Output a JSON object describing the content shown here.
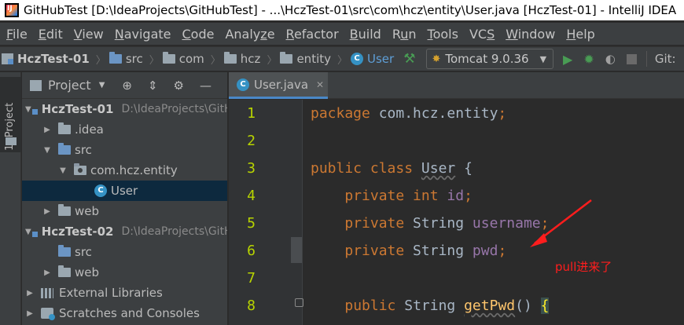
{
  "window": {
    "title": "GitHubTest [D:\\IdeaProjects\\GitHubTest] - ...\\HczTest-01\\src\\com\\hcz\\entity\\User.java [HczTest-01] - IntelliJ IDEA"
  },
  "menu": [
    {
      "pre": "",
      "ul": "F",
      "post": "ile"
    },
    {
      "pre": "",
      "ul": "E",
      "post": "dit"
    },
    {
      "pre": "",
      "ul": "V",
      "post": "iew"
    },
    {
      "pre": "",
      "ul": "N",
      "post": "avigate"
    },
    {
      "pre": "",
      "ul": "C",
      "post": "ode"
    },
    {
      "pre": "Analy",
      "ul": "z",
      "post": "e"
    },
    {
      "pre": "",
      "ul": "R",
      "post": "efactor"
    },
    {
      "pre": "",
      "ul": "B",
      "post": "uild"
    },
    {
      "pre": "R",
      "ul": "u",
      "post": "n"
    },
    {
      "pre": "",
      "ul": "T",
      "post": "ools"
    },
    {
      "pre": "VC",
      "ul": "S",
      "post": ""
    },
    {
      "pre": "",
      "ul": "W",
      "post": "indow"
    },
    {
      "pre": "",
      "ul": "H",
      "post": "elp"
    }
  ],
  "breadcrumb": {
    "project": "HczTest-01",
    "items": [
      "src",
      "com",
      "hcz",
      "entity"
    ],
    "current": "User"
  },
  "toolbar": {
    "run_config": "Tomcat 9.0.36",
    "git_label": "Git:"
  },
  "tool_strip": {
    "project_tab": "1: Project"
  },
  "project_panel": {
    "title": "Project",
    "tree": [
      {
        "label": "HczTest-01",
        "hint": "D:\\IdeaProjects\\GitHubTest\\HczTest-01",
        "bold": true
      },
      {
        "label": ".idea"
      },
      {
        "label": "src"
      },
      {
        "label": "com.hcz.entity"
      },
      {
        "label": "User"
      },
      {
        "label": "web"
      },
      {
        "label": "HczTest-02",
        "hint": "D:\\IdeaProjects\\GitHubTest\\HczTest-02",
        "bold": true
      },
      {
        "label": "src"
      },
      {
        "label": "web"
      },
      {
        "label": "External Libraries"
      },
      {
        "label": "Scratches and Consoles"
      }
    ]
  },
  "editor": {
    "tab": "User.java",
    "line_numbers": [
      "1",
      "2",
      "3",
      "4",
      "5",
      "6",
      "7",
      "8"
    ],
    "code": {
      "line1_kw": "package",
      "line1_rest": " com.hcz.entity",
      "line3_kw": "public class",
      "line3_name": "User",
      "line3_brace": " {",
      "line4_kw": "private int",
      "line4_field": "id",
      "line5_kw": "private",
      "line5_type": " String ",
      "line5_field": "username",
      "line6_kw": "private",
      "line6_type": " String ",
      "line6_field": "pwd",
      "line8_kw": "public",
      "line8_type": " String ",
      "line8_method": "getPwd",
      "line8_paren": "() ",
      "line8_brace": "{",
      "semicolon": ";"
    }
  },
  "annotation": {
    "text": "pull进来了",
    "color": "#ff1d1d"
  }
}
